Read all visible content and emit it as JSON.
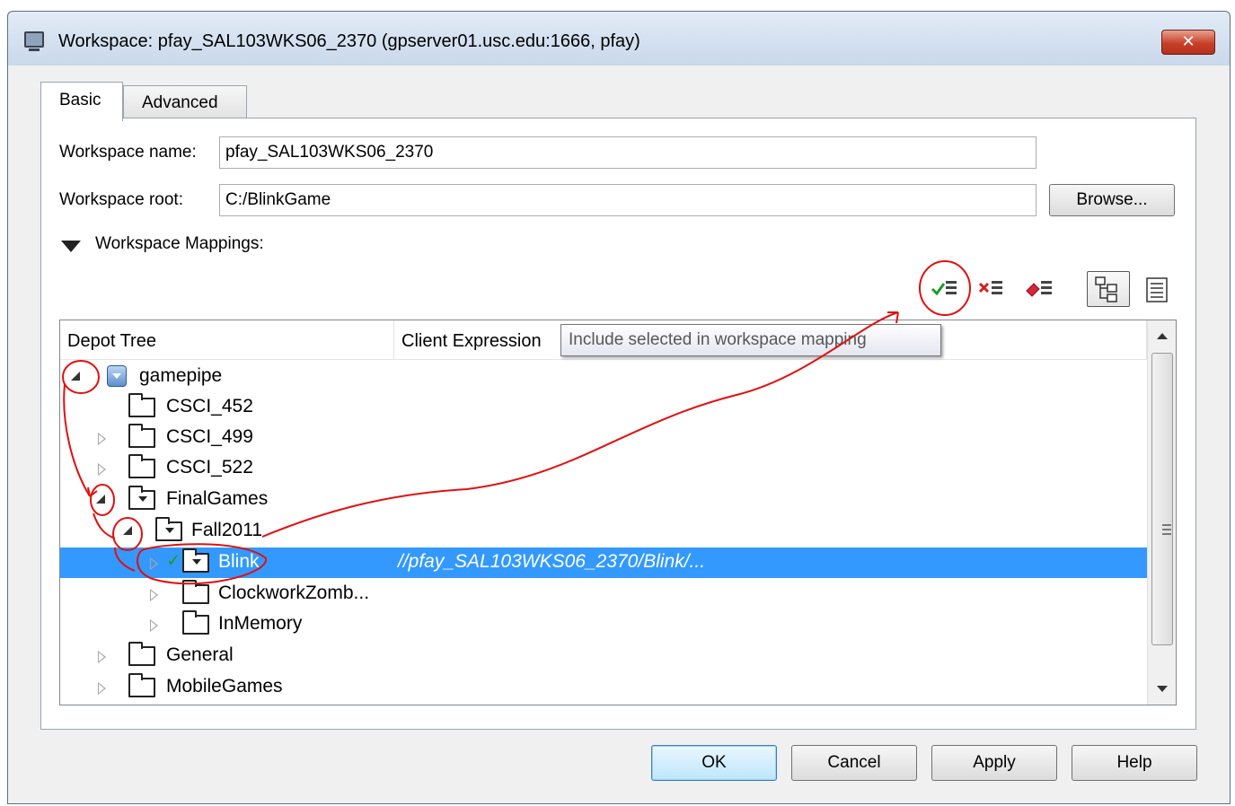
{
  "window": {
    "title": "Workspace: pfay_SAL103WKS06_2370 (gpserver01.usc.edu:1666, pfay)",
    "close_glyph": "✕"
  },
  "tabs": [
    {
      "label": "Basic",
      "selected": true
    },
    {
      "label": "Advanced",
      "selected": false
    }
  ],
  "form": {
    "workspace_name_label": "Workspace name:",
    "workspace_name_value": "pfay_SAL103WKS06_2370",
    "workspace_root_label": "Workspace root:",
    "workspace_root_value": "C:/BlinkGame",
    "browse_label": "Browse...",
    "mappings_label": "Workspace Mappings:"
  },
  "toolbar": {
    "icons": [
      "include-mapping-icon",
      "exclude-mapping-icon",
      "clear-mapping-icon",
      "tree-view-icon",
      "text-view-icon"
    ],
    "tooltip": "Include selected in workspace mapping"
  },
  "tree": {
    "columns": [
      "Depot Tree",
      "Client Expression"
    ],
    "rows": [
      {
        "label": "gamepipe",
        "client": ""
      },
      {
        "label": "CSCI_452",
        "client": ""
      },
      {
        "label": "CSCI_499",
        "client": ""
      },
      {
        "label": "CSCI_522",
        "client": ""
      },
      {
        "label": "FinalGames",
        "client": ""
      },
      {
        "label": "Fall2011",
        "client": ""
      },
      {
        "label": "Blink",
        "client": "//pfay_SAL103WKS06_2370/Blink/..."
      },
      {
        "label": "ClockworkZomb...",
        "client": ""
      },
      {
        "label": "InMemory",
        "client": ""
      },
      {
        "label": "General",
        "client": ""
      },
      {
        "label": "MobileGames",
        "client": ""
      }
    ]
  },
  "buttons": {
    "ok": "OK",
    "cancel": "Cancel",
    "apply": "Apply",
    "help": "Help"
  },
  "colors": {
    "selection": "#3399ff",
    "annotation": "#e01010",
    "check": "#1e9b27"
  }
}
